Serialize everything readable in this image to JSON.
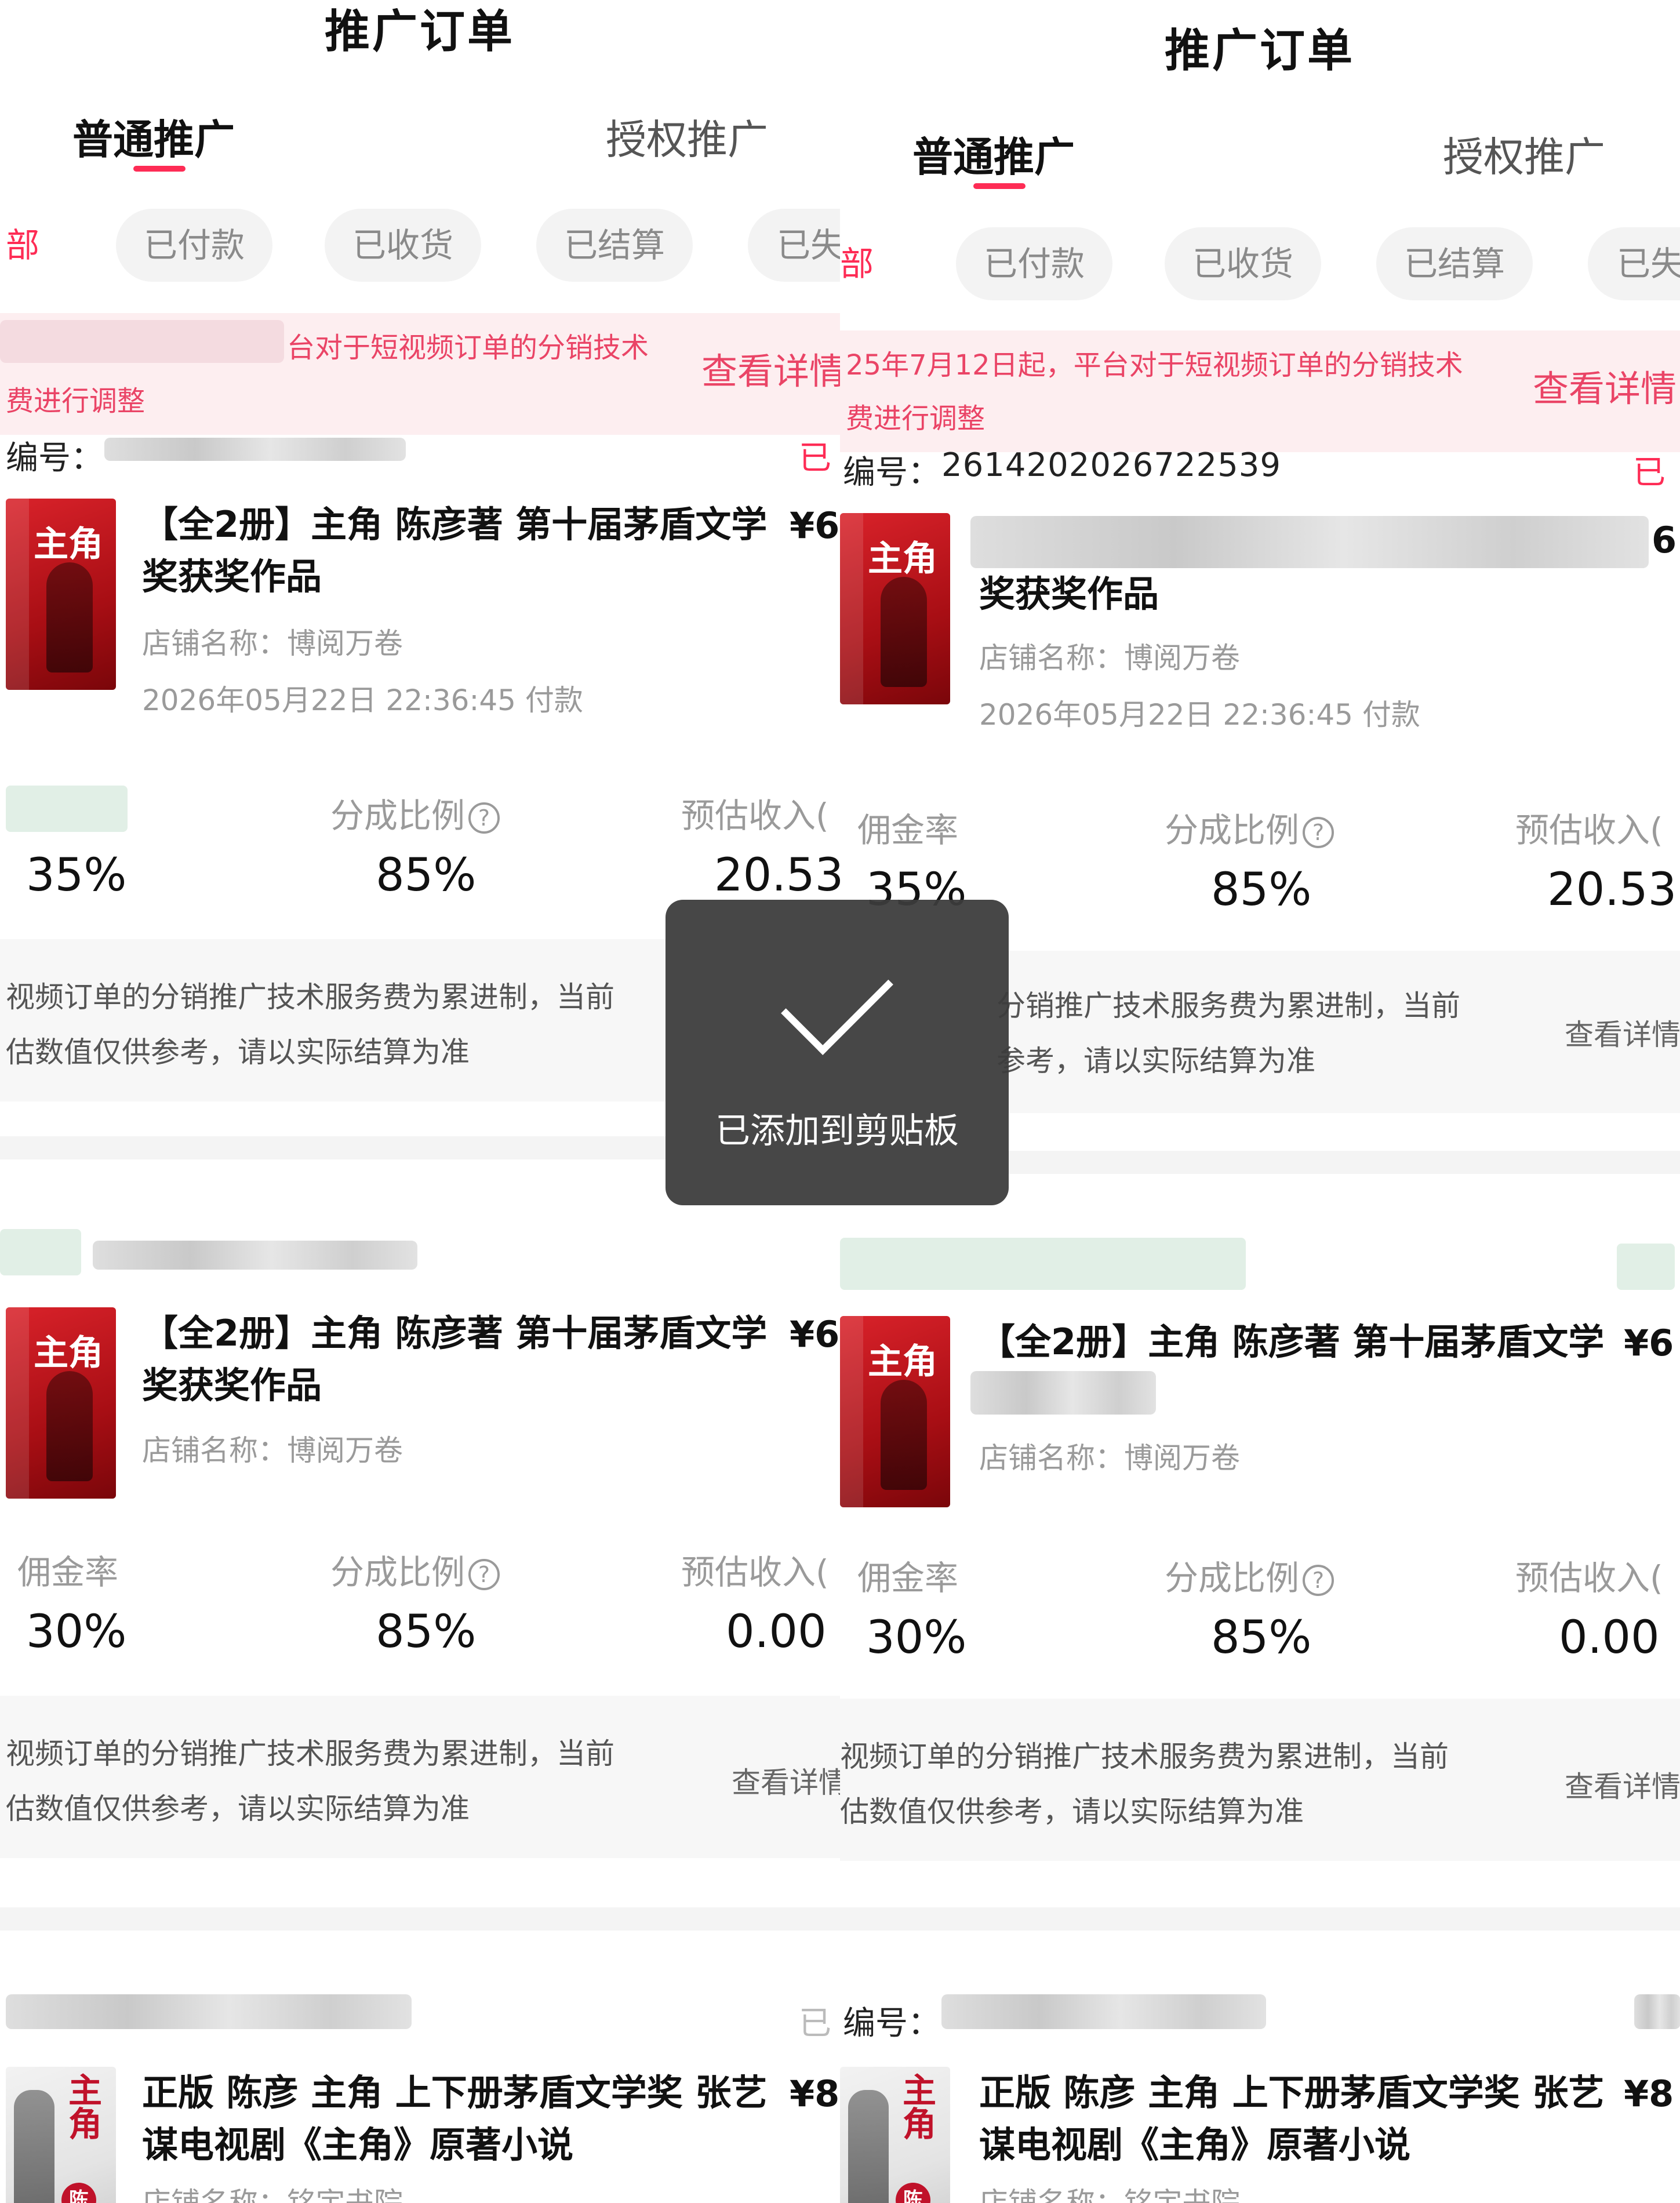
{
  "page_title": "推广订单",
  "tabs": [
    {
      "label": "普通推广",
      "active": true
    },
    {
      "label": "授权推广",
      "active": false
    }
  ],
  "filters": {
    "left": [
      "部",
      "已付款",
      "已收货",
      "已结算",
      "已失"
    ],
    "right": [
      "部",
      "已付款",
      "已收货",
      "已结算",
      "已失"
    ]
  },
  "notice": {
    "left_line1": "台对于短视频订单的分销技术",
    "left_line2": "费进行调整",
    "right_line1": "25年7月12日起，平台对于短视频订单的分销技术",
    "right_line2": "费进行调整",
    "link": "查看详情",
    "link_left": "查看详情",
    "link_right": "查看详情"
  },
  "order_label_left": "编号：",
  "order_label_right": "编号：",
  "order_number_right": "2614202026722539",
  "status_left": "已",
  "status_right": "已",
  "products": {
    "book1_title_line1": "【全2册】主角 陈彦著 第十届茅盾文学",
    "book1_title_line2": "奖获奖作品",
    "book1_price": "¥6",
    "book1_price_right": "¥6",
    "book1_price_right_alt": "6",
    "shop_boyue": "店铺名称：博阅万卷",
    "pay_time": "2026年05月22日 22:36:45 付款",
    "book2_title_line1": "正版 陈彦 主角 上下册茅盾文学奖 张艺",
    "book2_title_line2": "谋电视剧《主角》原著小说",
    "book2_price": "¥8",
    "book2_price_right": "¥8",
    "shop_cut": "店铺名称：铭宇书院",
    "cover_title": "主角",
    "cover_title_alt": "主角",
    "cover_badge": "陈彦"
  },
  "stats": {
    "commission_label": "佣金率",
    "share_label": "分成比例",
    "income_label": "预估收入(",
    "order1": {
      "commission": "35%",
      "share": "85%",
      "income": "20.53"
    },
    "order1_right_commission": "35%",
    "order2": {
      "commission": "30%",
      "share": "85%",
      "income": "0.00"
    }
  },
  "info": {
    "left_line1": "视频订单的分销推广技术服务费为累进制，当前",
    "left_line2": "估数值仅供参考，请以实际结算为准",
    "right1_line1": "分销推广技术服务费为累进制，当前",
    "right1_line2": "参考，请以实际结算为准",
    "right2_line1": "视频订单的分销推广技术服务费为累进制，当前",
    "right2_line2": "估数值仅供参考，请以实际结算为准",
    "link": "查看详情"
  },
  "toast": {
    "text": "已添加到剪贴板",
    "icon": "checkmark-icon"
  },
  "colors": {
    "accent": "#fe2c55",
    "notice_bg": "#fdeef0",
    "toast_bg": "#3c3c3c"
  }
}
